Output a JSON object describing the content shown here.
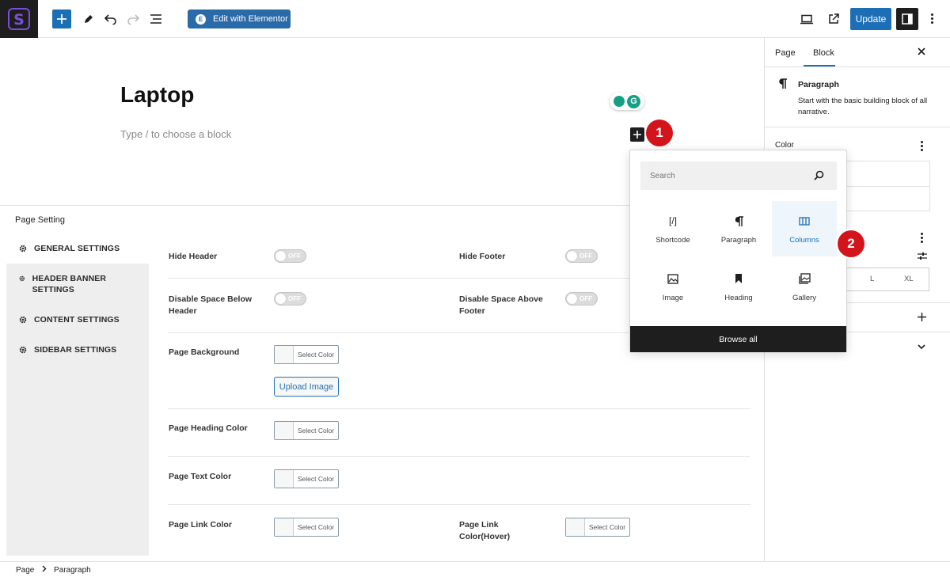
{
  "toolbar": {
    "elementor_label": "Edit with Elementor",
    "elementor_badge": "E",
    "update_label": "Update"
  },
  "editor": {
    "title": "Laptop",
    "placeholder": "Type / to choose a block",
    "grammarly_letter": "G"
  },
  "annotations": {
    "step1": "1",
    "step2": "2"
  },
  "inserter": {
    "search_placeholder": "Search",
    "blocks": [
      {
        "label": "Shortcode",
        "icon": "shortcode-icon"
      },
      {
        "label": "Paragraph",
        "icon": "paragraph-icon"
      },
      {
        "label": "Columns",
        "icon": "columns-icon"
      },
      {
        "label": "Image",
        "icon": "image-icon"
      },
      {
        "label": "Heading",
        "icon": "bookmark-icon"
      },
      {
        "label": "Gallery",
        "icon": "gallery-icon"
      }
    ],
    "browse_all": "Browse all",
    "shortcode_glyph": "[/]"
  },
  "metabox": {
    "title": "Page Setting",
    "nav": [
      {
        "label": "GENERAL SETTINGS"
      },
      {
        "label": "HEADER BANNER SETTINGS"
      },
      {
        "label": "CONTENT SETTINGS"
      },
      {
        "label": "SIDEBAR SETTINGS"
      }
    ],
    "fields": {
      "hide_header": "Hide Header",
      "hide_footer": "Hide Footer",
      "disable_below_header": "Disable Space Below Header",
      "disable_above_footer": "Disable Space Above Footer",
      "page_background": "Page Background",
      "page_heading_color": "Page Heading Color",
      "page_text_color": "Page Text Color",
      "page_link_color": "Page Link Color",
      "page_link_hover": "Page Link Color(Hover)"
    },
    "toggle_off": "OFF",
    "select_color": "Select Color",
    "upload_image": "Upload Image"
  },
  "sidebar": {
    "tab_page": "Page",
    "tab_block": "Block",
    "block_name": "Paragraph",
    "block_desc": "Start with the basic building block of all narrative.",
    "color_label": "Color",
    "size_l": "L",
    "size_xl": "XL"
  },
  "breadcrumb": {
    "page": "Page",
    "paragraph": "Paragraph"
  },
  "colors": {
    "accent": "#1c6fb5",
    "annotation": "#d4141b",
    "dark": "#1e1e1e"
  }
}
